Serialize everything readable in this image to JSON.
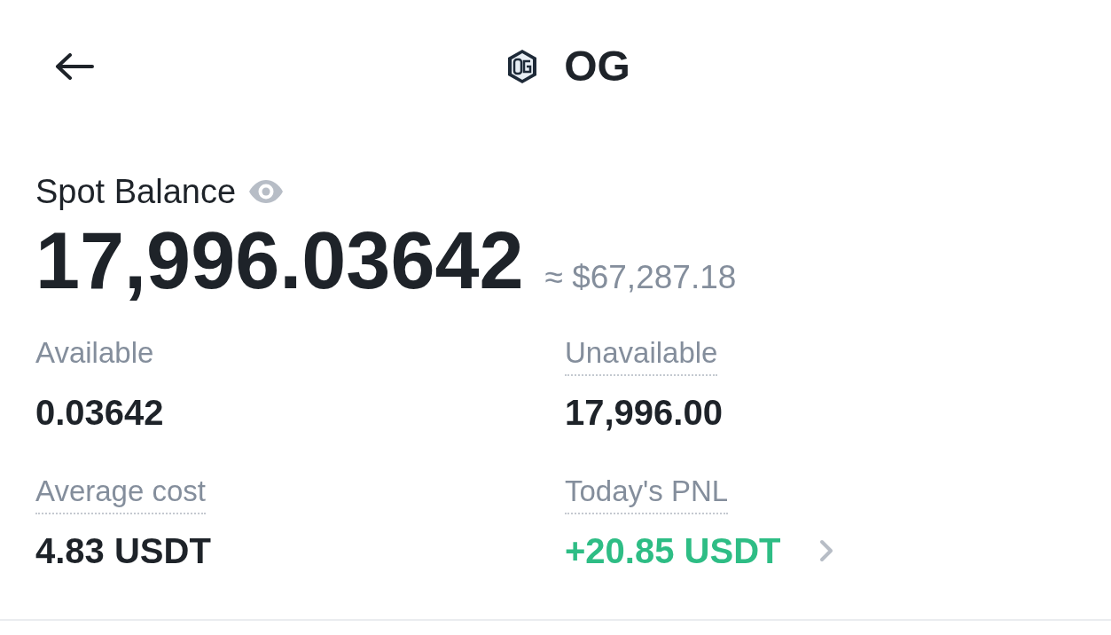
{
  "header": {
    "title": "OG"
  },
  "balance": {
    "label": "Spot Balance",
    "amount": "17,996.03642",
    "approx_value": "≈ $67,287.18"
  },
  "stats": [
    {
      "label": "Available",
      "value": "0.03642",
      "dotted_underline": false,
      "color": "#1e2329",
      "chevron": false
    },
    {
      "label": "Unavailable",
      "value": "17,996.00",
      "dotted_underline": true,
      "color": "#1e2329",
      "chevron": false
    },
    {
      "label": "Average cost",
      "value": "4.83 USDT",
      "dotted_underline": true,
      "color": "#1e2329",
      "chevron": false
    },
    {
      "label": "Today's PNL",
      "value": "+20.85 USDT",
      "dotted_underline": true,
      "color": "#2ebd85",
      "chevron": true
    }
  ]
}
